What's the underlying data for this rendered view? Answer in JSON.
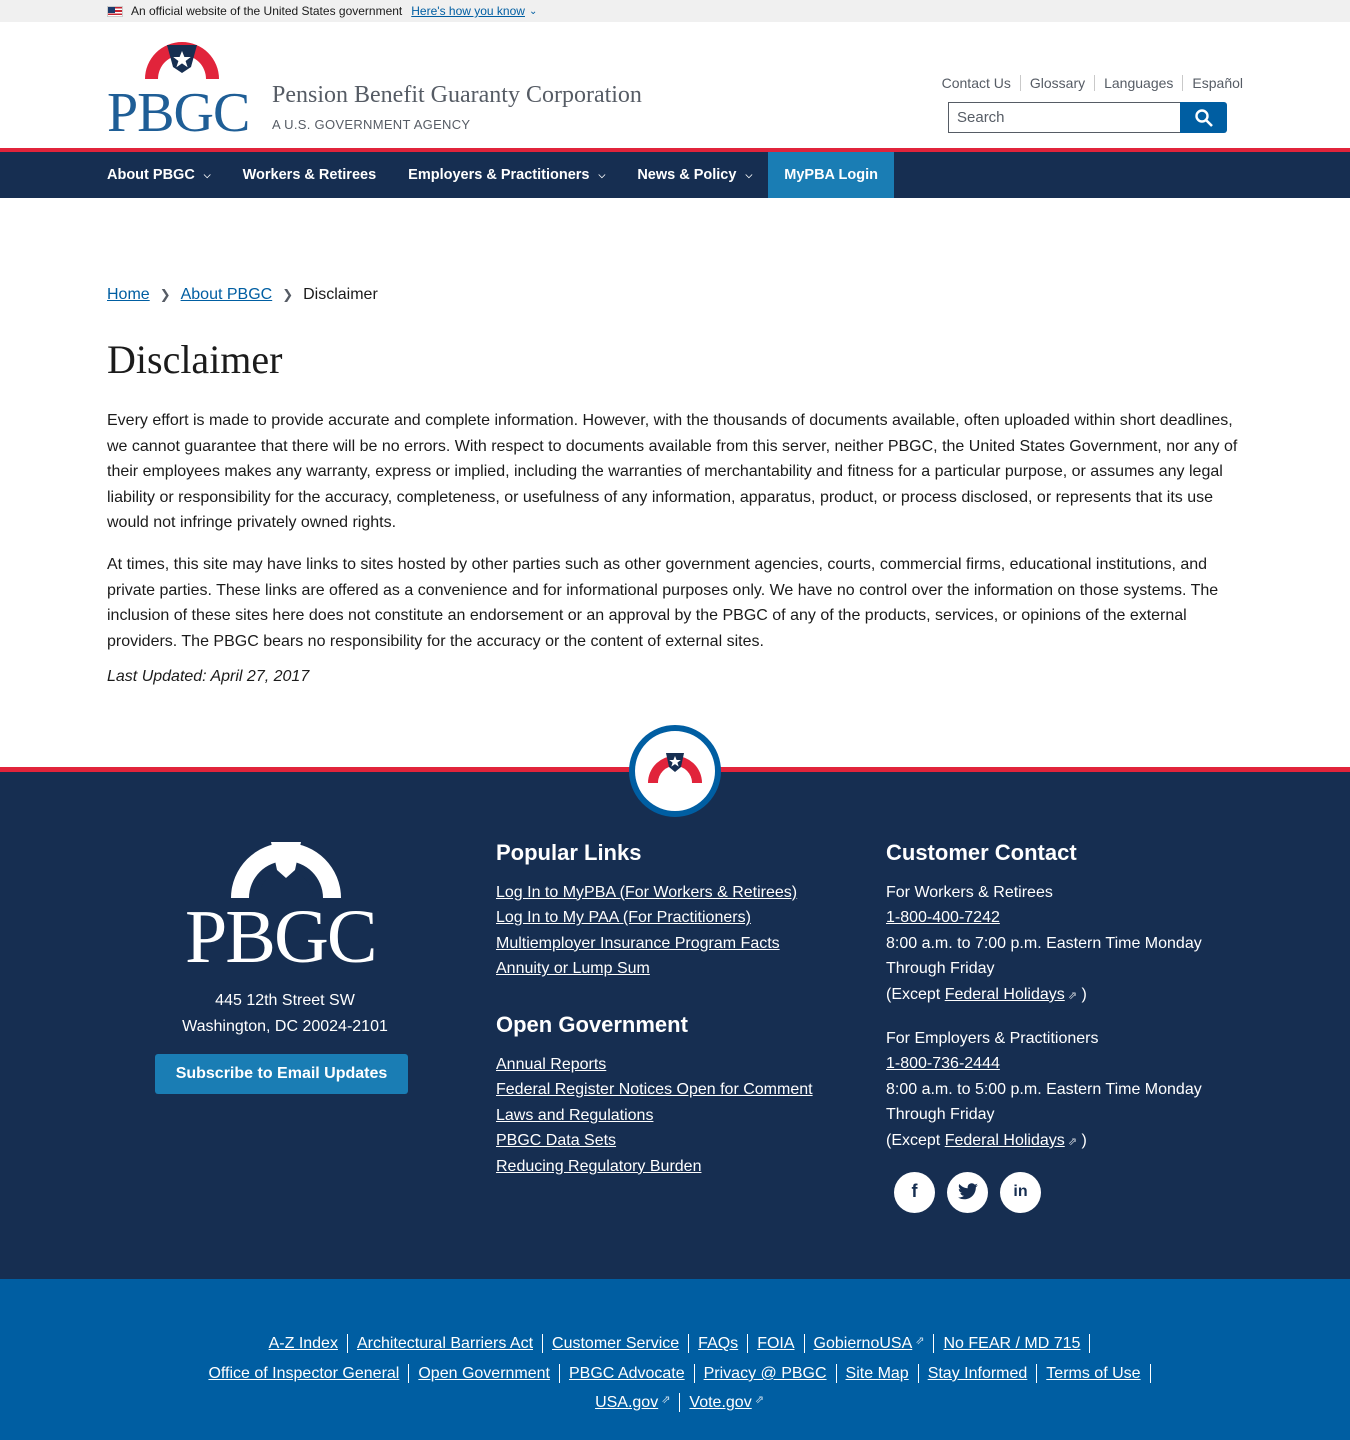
{
  "gov_banner": {
    "text": "An official website of the United States government",
    "link": "Here's how you know"
  },
  "header": {
    "logo_text": "PBGC",
    "agency_name": "Pension Benefit Guaranty Corporation",
    "agency_sub": "A U.S. GOVERNMENT AGENCY",
    "util_links": [
      "Contact Us",
      "Glossary",
      "Languages",
      "Español"
    ],
    "search_placeholder": "Search"
  },
  "nav": {
    "items": [
      {
        "label": "About PBGC",
        "dropdown": true
      },
      {
        "label": "Workers & Retirees",
        "dropdown": false
      },
      {
        "label": "Employers & Practitioners",
        "dropdown": true
      },
      {
        "label": "News & Policy",
        "dropdown": true
      },
      {
        "label": "MyPBA Login",
        "dropdown": false
      }
    ]
  },
  "breadcrumb": [
    "Home",
    "About PBGC",
    "Disclaimer"
  ],
  "page": {
    "title": "Disclaimer",
    "paragraphs": [
      "Every effort is made to provide accurate and complete information. However, with the thousands of documents available, often uploaded within short deadlines, we cannot guarantee that there will be no errors. With respect to documents available from this server, neither PBGC, the United States Government, nor any of their employees makes any warranty, express or implied, including the warranties of merchantability and fitness for a particular purpose, or assumes any legal liability or responsibility for the accuracy, completeness, or usefulness of any information, apparatus, product, or process disclosed, or represents that its use would not infringe privately owned rights.",
      "At times, this site may have links to sites hosted by other parties such as other government agencies, courts, commercial firms, educational institutions, and private parties. These links are offered as a convenience and for informational purposes only. We have no control over the information on those systems. The inclusion of these sites here does not constitute an endorsement or an approval by the PBGC of any of the products, services, or opinions of the external providers. The PBGC bears no responsibility for the accuracy or the content of external sites."
    ],
    "updated": "Last Updated: April 27, 2017"
  },
  "footer": {
    "logo_text": "PBGC",
    "address_line1": "445 12th Street SW",
    "address_line2": "Washington, DC 20024-2101",
    "subscribe": "Subscribe to Email Updates",
    "popular_title": "Popular Links",
    "popular_links": [
      "Log In to MyPBA (For Workers & Retirees)",
      "Log In to My PAA (For Practitioners)",
      "Multiemployer Insurance Program Facts",
      "Annuity or Lump Sum"
    ],
    "open_gov_title": "Open Government",
    "open_gov_links": [
      "Annual Reports",
      "Federal Register Notices Open for Comment",
      "Laws and Regulations",
      "PBGC Data Sets",
      "Reducing Regulatory Burden"
    ],
    "contact_title": "Customer Contact",
    "contacts": [
      {
        "who": "For Workers & Retirees",
        "phone": "1-800-400-7242",
        "hours": "8:00 a.m. to 7:00 p.m. Eastern Time Monday Through Friday",
        "except_prefix": "(Except",
        "holidays": "Federal Holidays",
        "except_suffix": ")"
      },
      {
        "who": "For Employers & Practitioners",
        "phone": "1-800-736-2444",
        "hours": "8:00 a.m. to 5:00 p.m. Eastern Time Monday Through Friday",
        "except_prefix": "(Except",
        "holidays": "Federal Holidays",
        "except_suffix": ")"
      }
    ],
    "social_icons": [
      "facebook-icon",
      "twitter-icon",
      "linkedin-icon"
    ]
  },
  "subfooter": {
    "row1": [
      "A-Z Index",
      "Architectural Barriers Act",
      "Customer Service",
      "FAQs",
      "FOIA",
      "GobiernoUSA",
      "No FEAR / MD 715"
    ],
    "row2": [
      "Office of Inspector General",
      "Open Government",
      "PBGC Advocate",
      "Privacy @ PBGC",
      "Site Map",
      "Stay Informed",
      "Terms of Use"
    ],
    "row3": [
      "USA.gov",
      "Vote.gov"
    ]
  },
  "colors": {
    "navy": "#162e51",
    "blue": "#005ea2",
    "teal": "#1a7db4",
    "red": "#e1243b"
  }
}
